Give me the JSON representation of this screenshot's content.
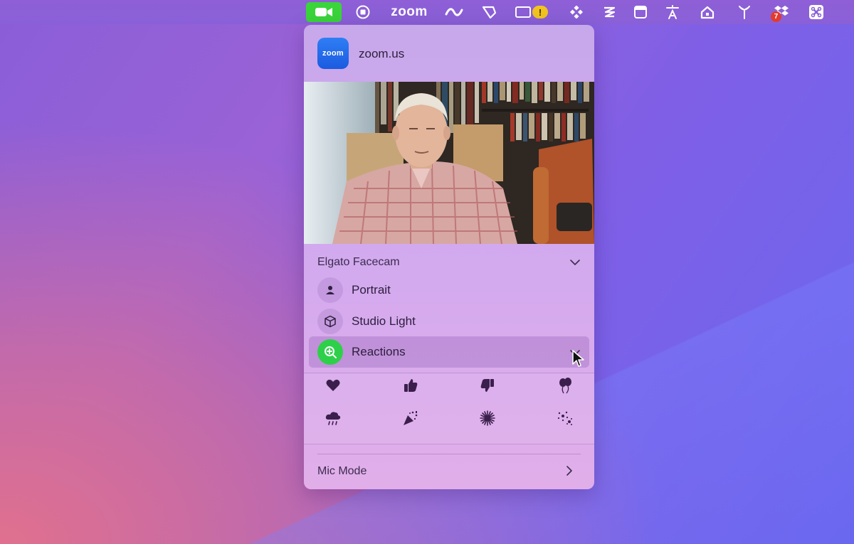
{
  "menubar": {
    "zoom_label": "zoom",
    "warning_badge": "!",
    "dropbox_badge": "7",
    "icons": [
      "video-icon",
      "record-icon",
      "zoom-wordmark",
      "link-icon",
      "pen-tool-icon",
      "battery-warning-icon",
      "dropbox-grid-icon",
      "stack-icon",
      "window-icon",
      "translate-icon",
      "home-icon",
      "antenna-icon",
      "dropbox-icon",
      "command-icon"
    ]
  },
  "panel": {
    "app_name": "zoom.us",
    "app_icon_text": "zoom",
    "camera": {
      "label": "Elgato Facecam"
    },
    "options": [
      {
        "label": "Portrait",
        "icon": "person-icon"
      },
      {
        "label": "Studio Light",
        "icon": "cube-icon"
      },
      {
        "label": "Reactions",
        "icon": "reaction-plus-icon",
        "highlighted": true
      }
    ],
    "reactions": [
      "heart-icon",
      "thumbs-up-icon",
      "thumbs-down-icon",
      "balloons-icon",
      "rain-cloud-icon",
      "confetti-icon",
      "fireworks-icon",
      "sparkler-icon"
    ],
    "mic_mode": {
      "label": "Mic Mode"
    }
  },
  "colors": {
    "accent_green": "#3ad53a",
    "panel_tint": "#d1a9ef"
  }
}
